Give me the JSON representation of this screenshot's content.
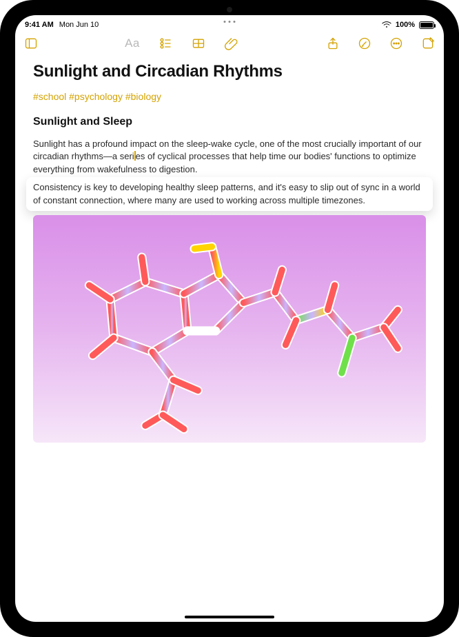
{
  "status": {
    "time": "9:41 AM",
    "date": "Mon Jun 10",
    "battery_pct": "100%"
  },
  "toolbar": {
    "sidebar_icon": "sidebar-icon",
    "format_label": "Aa",
    "checklist_icon": "checklist-icon",
    "table_icon": "table-icon",
    "attach_icon": "paperclip-icon",
    "share_icon": "share-icon",
    "markup_icon": "pencil-circle-icon",
    "more_icon": "more-icon",
    "compose_icon": "compose-icon"
  },
  "note": {
    "title": "Sunlight and Circadian Rhythms",
    "tags": "#school #psychology #biology",
    "subheading": "Sunlight and Sleep",
    "paragraph_before_caret": "Sunlight has a profound impact on the sleep-wake cycle, one of the most crucially important of our circadian rhythms—a seri",
    "paragraph_after_caret": "es of cyclical processes that help time our bodies' functions to optimize everything from wakefulness to digestion.",
    "drag_text": "Consistency is key to developing healthy sleep patterns, and it's easy to slip out of sync in a world of constant connection, where many are used to working across multiple timezones.",
    "image_description": "3D molecular structure on purple gradient"
  }
}
